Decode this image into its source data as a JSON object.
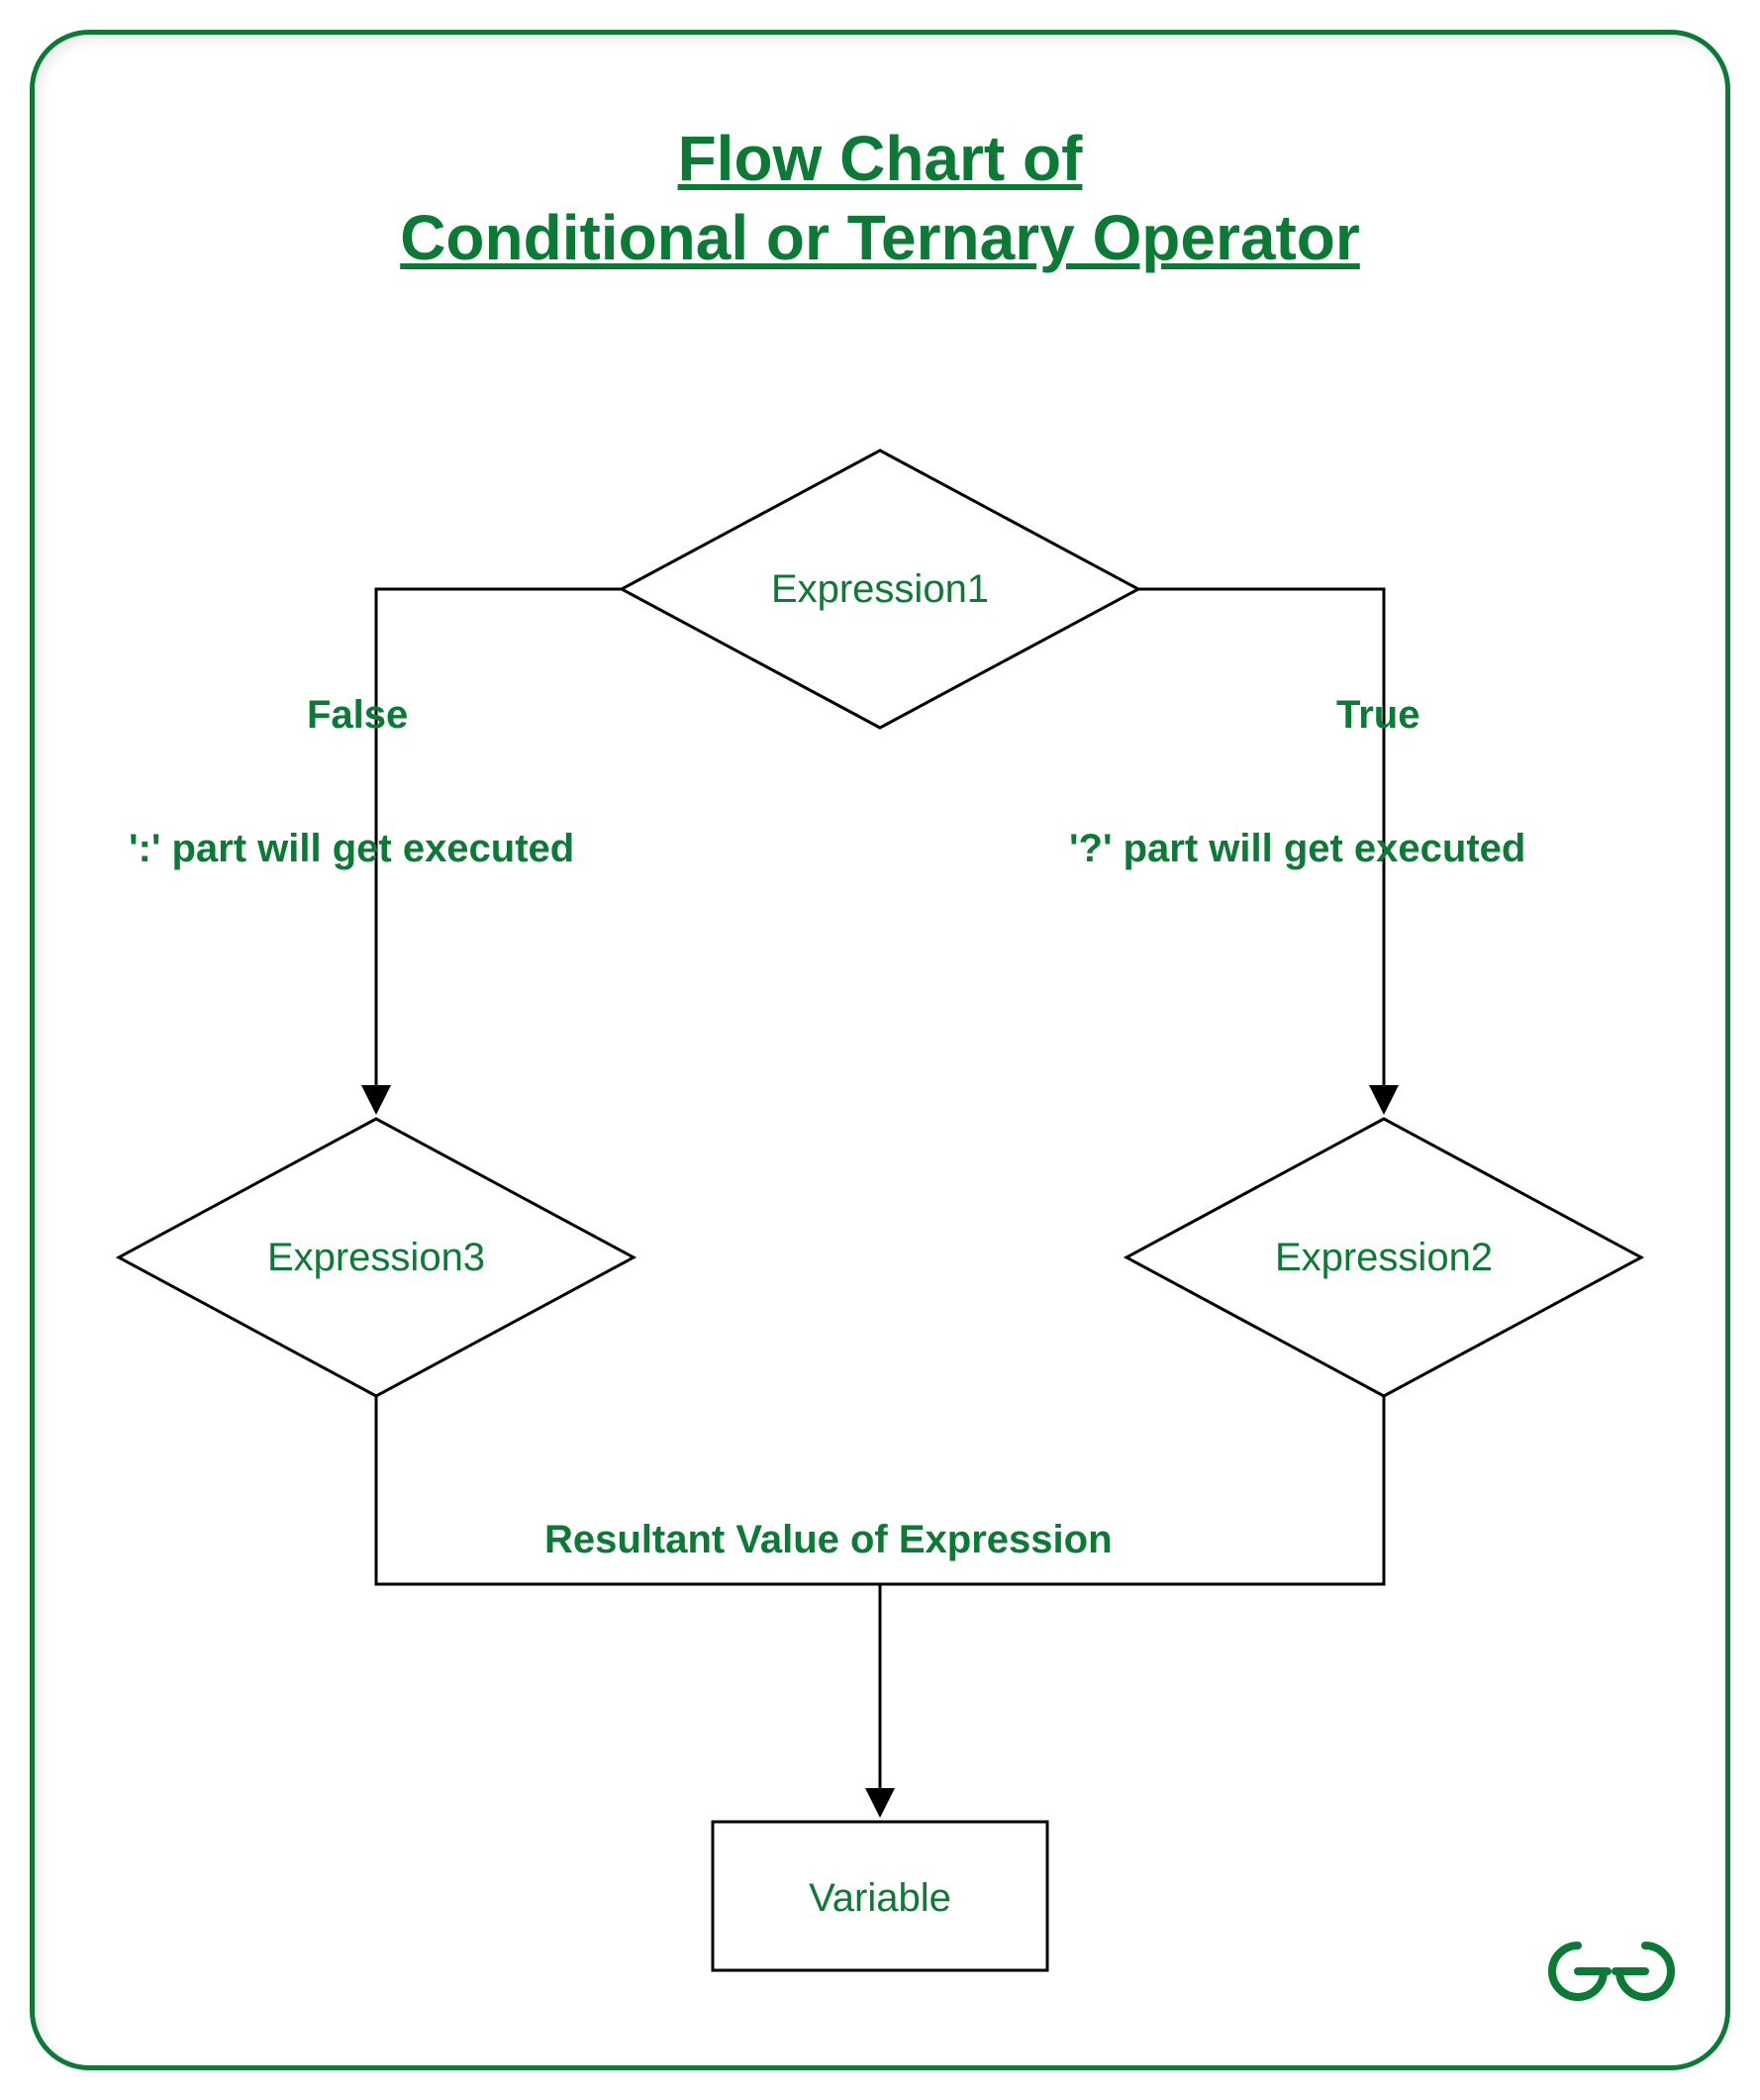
{
  "title_line1": "Flow Chart of",
  "title_line2": "Conditional or Ternary Operator",
  "nodes": {
    "expression1": "Expression1",
    "expression2": "Expression2",
    "expression3": "Expression3",
    "variable": "Variable"
  },
  "labels": {
    "false": "False",
    "true": "True",
    "colon_exec": "':' part will get executed",
    "question_exec": "'?' part will get executed",
    "resultant": "Resultant Value of Expression"
  },
  "colors": {
    "green": "#0b7a35",
    "black": "#000000"
  }
}
